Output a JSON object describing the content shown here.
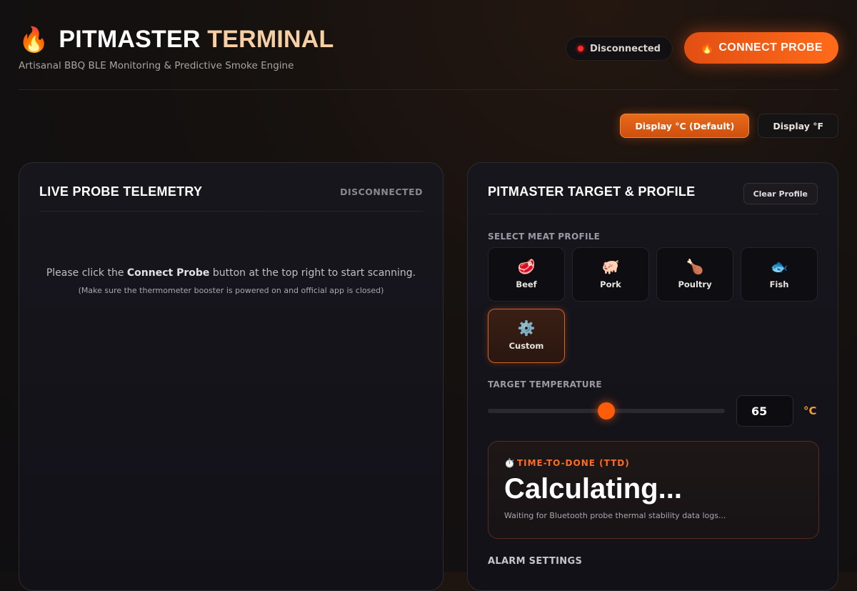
{
  "header": {
    "logo_icon": "🔥",
    "title_main": "PITMASTER",
    "title_accent": "TERMINAL",
    "subtitle": "Artisanal BBQ BLE Monitoring & Predictive Smoke Engine",
    "status_label": "Disconnected",
    "status_color": "#ff2a2a",
    "connect_icon": "🔥",
    "connect_label": "CONNECT PROBE"
  },
  "units": {
    "celsius_label": "Display °C (Default)",
    "fahrenheit_label": "Display °F",
    "active": "celsius"
  },
  "telemetry": {
    "title": "LIVE PROBE TELEMETRY",
    "status": "DISCONNECTED",
    "msg_prefix": "Please click the ",
    "msg_bold": "Connect Probe",
    "msg_suffix": " button at the top right to start scanning.",
    "hint": "(Make sure the thermometer booster is powered on and official app is closed)"
  },
  "profile": {
    "title": "PITMASTER TARGET & PROFILE",
    "clear_label": "Clear Profile",
    "select_label": "SELECT MEAT PROFILE",
    "items": [
      {
        "icon": "🥩",
        "label": "Beef"
      },
      {
        "icon": "🐖",
        "label": "Pork"
      },
      {
        "icon": "🍗",
        "label": "Poultry"
      },
      {
        "icon": "🐟",
        "label": "Fish"
      },
      {
        "icon": "⚙️",
        "label": "Custom"
      }
    ],
    "selected": "Custom",
    "target_label": "TARGET TEMPERATURE",
    "target_value": "65",
    "target_slider_fraction": 0.5,
    "target_unit": "°C",
    "ttd_icon": "⏱️",
    "ttd_label": "TIME-TO-DONE (TTD)",
    "ttd_value": "Calculating...",
    "ttd_note": "Waiting for Bluetooth probe thermal stability data logs...",
    "alarm_label": "ALARM SETTINGS"
  }
}
